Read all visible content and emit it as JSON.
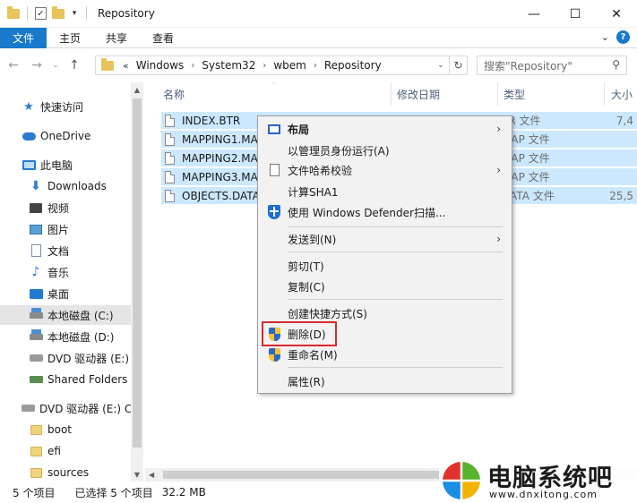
{
  "window": {
    "title": "Repository",
    "controls": {
      "minimize": "—",
      "maximize": "☐",
      "close": "✕"
    }
  },
  "ribbon": {
    "tabs": [
      "文件",
      "主页",
      "共享",
      "查看"
    ],
    "help": "?"
  },
  "nav": {
    "address_overflow": "«",
    "breadcrumb": [
      "Windows",
      "System32",
      "wbem",
      "Repository"
    ],
    "search_placeholder": "搜索\"Repository\""
  },
  "sidebar": {
    "items": [
      {
        "label": "快速访问",
        "icon": "star-icon"
      },
      {
        "label": "OneDrive",
        "icon": "cloud-icon"
      },
      {
        "label": "此电脑",
        "icon": "computer-icon"
      },
      {
        "label": "Downloads",
        "icon": "download-icon"
      },
      {
        "label": "视频",
        "icon": "video-icon"
      },
      {
        "label": "图片",
        "icon": "picture-icon"
      },
      {
        "label": "文档",
        "icon": "document-icon"
      },
      {
        "label": "音乐",
        "icon": "music-icon"
      },
      {
        "label": "桌面",
        "icon": "desktop-icon"
      },
      {
        "label": "本地磁盘 (C:)",
        "icon": "disk-icon",
        "selected": true
      },
      {
        "label": "本地磁盘 (D:)",
        "icon": "disk-icon"
      },
      {
        "label": "DVD 驱动器 (E:)",
        "icon": "dvd-icon"
      },
      {
        "label": "Shared Folders",
        "icon": "shared-folder-icon"
      },
      {
        "label": "DVD 驱动器 (E:) C",
        "icon": "dvd-icon"
      },
      {
        "label": "boot",
        "icon": "folder-icon"
      },
      {
        "label": "efi",
        "icon": "folder-icon"
      },
      {
        "label": "sources",
        "icon": "folder-icon"
      }
    ]
  },
  "columns": [
    "名称",
    "修改日期",
    "类型",
    "大小"
  ],
  "files": [
    {
      "name": "INDEX.BTR",
      "type": "TR 文件",
      "size": "7,4"
    },
    {
      "name": "MAPPING1.MA",
      "type": "MAP 文件",
      "size": ""
    },
    {
      "name": "MAPPING2.MA",
      "type": "MAP 文件",
      "size": ""
    },
    {
      "name": "MAPPING3.MA",
      "type": "MAP 文件",
      "size": ""
    },
    {
      "name": "OBJECTS.DATA",
      "type": "DATA 文件",
      "size": "25,5"
    }
  ],
  "context_menu": {
    "items": {
      "layout": "布局",
      "run_as_admin": "以管理员身份运行(A)",
      "hash": "文件哈希校验",
      "sha1": "计算SHA1",
      "defender": "使用 Windows Defender扫描...",
      "send_to": "发送到(N)",
      "cut": "剪切(T)",
      "copy": "复制(C)",
      "create_shortcut": "创建快捷方式(S)",
      "delete": "删除(D)",
      "rename": "重命名(M)",
      "properties": "属性(R)"
    }
  },
  "status": {
    "count": "5 个项目",
    "selected": "已选择 5 个项目",
    "size": "32.2 MB"
  },
  "watermark": {
    "name": "电脑系统吧",
    "url": "www.dnxitong.com"
  },
  "colors": {
    "accent": "#1979ca",
    "selection": "#cce8ff",
    "highlight_border": "#d8282f"
  }
}
